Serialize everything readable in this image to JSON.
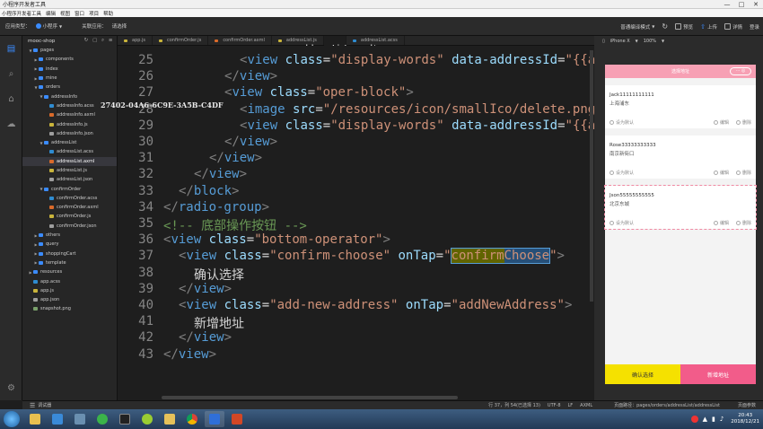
{
  "window": {
    "title": "小程序开发者工具",
    "controls": [
      "—",
      "□",
      "✕"
    ]
  },
  "menu": [
    "小程序开发者工具",
    "编辑",
    "视图",
    "窗口",
    "项目",
    "帮助"
  ],
  "toolbar": {
    "app_type_label": "应用类型：",
    "app_type_value": "小程序",
    "mode_label": "关联应用：",
    "mode_value": "请选择",
    "compile_mode": "普通编译模式",
    "preview_label": "预览",
    "upload_label": "上传",
    "details_label": "详情",
    "login_label": "登录"
  },
  "watermark": "27402-04A6-6C9E-3A5B-C4DF",
  "sidebar": {
    "project": "mooc-shop",
    "tree": [
      {
        "label": "pages",
        "type": "folder",
        "indent": 1,
        "open": true
      },
      {
        "label": "components",
        "type": "folder",
        "indent": 2,
        "open": false
      },
      {
        "label": "index",
        "type": "folder",
        "indent": 2,
        "open": false
      },
      {
        "label": "mine",
        "type": "folder",
        "indent": 2,
        "open": false
      },
      {
        "label": "orders",
        "type": "folder",
        "indent": 2,
        "open": true
      },
      {
        "label": "addressInfo",
        "type": "folder",
        "indent": 3,
        "open": true
      },
      {
        "label": "addressInfo.acss",
        "type": "wxss",
        "indent": 4
      },
      {
        "label": "addressInfo.axml",
        "type": "wxml",
        "indent": 4
      },
      {
        "label": "addressInfo.js",
        "type": "js",
        "indent": 4
      },
      {
        "label": "addressInfo.json",
        "type": "json",
        "indent": 4
      },
      {
        "label": "addressList",
        "type": "folder",
        "indent": 3,
        "open": true
      },
      {
        "label": "addressList.acss",
        "type": "wxss",
        "indent": 4
      },
      {
        "label": "addressList.axml",
        "type": "wxml",
        "indent": 4,
        "selected": true
      },
      {
        "label": "addressList.js",
        "type": "js",
        "indent": 4
      },
      {
        "label": "addressList.json",
        "type": "json",
        "indent": 4
      },
      {
        "label": "confirmOrder",
        "type": "folder",
        "indent": 3,
        "open": true
      },
      {
        "label": "confirmOrder.acss",
        "type": "wxss",
        "indent": 4
      },
      {
        "label": "confirmOrder.axml",
        "type": "wxml",
        "indent": 4
      },
      {
        "label": "confirmOrder.js",
        "type": "js",
        "indent": 4
      },
      {
        "label": "confirmOrder.json",
        "type": "json",
        "indent": 4
      },
      {
        "label": "others",
        "type": "folder",
        "indent": 2,
        "open": false
      },
      {
        "label": "query",
        "type": "folder",
        "indent": 2,
        "open": false
      },
      {
        "label": "shoppingCart",
        "type": "folder",
        "indent": 2,
        "open": false
      },
      {
        "label": "template",
        "type": "folder",
        "indent": 2,
        "open": false
      },
      {
        "label": "resources",
        "type": "folder",
        "indent": 1,
        "open": false
      },
      {
        "label": "app.acss",
        "type": "wxss",
        "indent": 1
      },
      {
        "label": "app.js",
        "type": "js",
        "indent": 1
      },
      {
        "label": "app.json",
        "type": "json",
        "indent": 1
      },
      {
        "label": "snapshot.png",
        "type": "png",
        "indent": 1
      }
    ]
  },
  "tabs": [
    {
      "label": "app.js",
      "type": "js"
    },
    {
      "label": "confirmOrder.js",
      "type": "js"
    },
    {
      "label": "confirmOrder.axml",
      "type": "wxml"
    },
    {
      "label": "addressList.js",
      "type": "js"
    },
    {
      "label": "addressList.axml*",
      "type": "wxml",
      "active": true
    },
    {
      "label": "addressList.acss",
      "type": "wxss"
    }
  ],
  "editor": {
    "lines": [
      {
        "n": "25",
        "indent": 5,
        "html": "<span class=\"p\">&lt;</span><span class=\"t\">view</span> <span class=\"a\">class</span>=<span class=\"s\">\"display-words\"</span> <span class=\"a\">data-addressId</span>=<span class=\"s\">\"{{address.id}}\"</span> <span class=\"a\">on</span>"
      },
      {
        "n": "26",
        "indent": 4,
        "html": "<span class=\"p\">&lt;/</span><span class=\"t\">view</span><span class=\"p\">&gt;</span>"
      },
      {
        "n": "27",
        "indent": 4,
        "html": "<span class=\"p\">&lt;</span><span class=\"t\">view</span> <span class=\"a\">class</span>=<span class=\"s\">\"oper-block\"</span><span class=\"p\">&gt;</span>"
      },
      {
        "n": "28",
        "indent": 5,
        "html": "<span class=\"p\">&lt;</span><span class=\"t\">image</span> <span class=\"a\">src</span>=<span class=\"s\">\"/resources/icon/smallIco/delete.png\"</span> <span class=\"a\">class</span>=<span class=\"s\">\"oper-</span>"
      },
      {
        "n": "29",
        "indent": 5,
        "html": "<span class=\"p\">&lt;</span><span class=\"t\">view</span> <span class=\"a\">class</span>=<span class=\"s\">\"display-words\"</span> <span class=\"a\">data-addressId</span>=<span class=\"s\">\"{{address.id}}\"</span> <span class=\"a\">on</span>"
      },
      {
        "n": "30",
        "indent": 4,
        "html": "<span class=\"p\">&lt;/</span><span class=\"t\">view</span><span class=\"p\">&gt;</span>"
      },
      {
        "n": "31",
        "indent": 3,
        "html": "<span class=\"p\">&lt;/</span><span class=\"t\">view</span><span class=\"p\">&gt;</span>"
      },
      {
        "n": "32",
        "indent": 2,
        "html": "<span class=\"p\">&lt;/</span><span class=\"t\">view</span><span class=\"p\">&gt;</span>"
      },
      {
        "n": "33",
        "indent": 1,
        "html": "<span class=\"p\">&lt;/</span><span class=\"t\">block</span><span class=\"p\">&gt;</span>"
      },
      {
        "n": "34",
        "indent": 0,
        "html": "<span class=\"p\">&lt;/</span><span class=\"t\">radio-group</span><span class=\"p\">&gt;</span>"
      },
      {
        "n": "35",
        "indent": 0,
        "html": "<span class=\"c\">&lt;!-- 底部操作按钮 --&gt;</span>"
      },
      {
        "n": "36",
        "indent": 0,
        "html": "<span class=\"p\">&lt;</span><span class=\"t\">view</span> <span class=\"a\">class</span>=<span class=\"s\">\"bottom-operator\"</span><span class=\"p\">&gt;</span>"
      },
      {
        "n": "37",
        "indent": 1,
        "html": "<span class=\"p\">&lt;</span><span class=\"t\">view</span> <span class=\"a\">class</span>=<span class=\"s\">\"confirm-choose\"</span> <span class=\"a\">onTap</span>=<span class=\"s\">\"<span class=\"hl\"><span class=\"hl2\">confirm</span>Choose</span>\"</span><span class=\"p\">&gt;</span>"
      },
      {
        "n": "38",
        "indent": 2,
        "html": "确认选择"
      },
      {
        "n": "39",
        "indent": 1,
        "html": "<span class=\"p\">&lt;/</span><span class=\"t\">view</span><span class=\"p\">&gt;</span>"
      },
      {
        "n": "40",
        "indent": 1,
        "html": "<span class=\"p\">&lt;</span><span class=\"t\">view</span> <span class=\"a\">class</span>=<span class=\"s\">\"add-new-address\"</span> <span class=\"a\">onTap</span>=<span class=\"s\">\"addNewAddress\"</span><span class=\"p\">&gt;</span>"
      },
      {
        "n": "41",
        "indent": 2,
        "html": "新增地址"
      },
      {
        "n": "42",
        "indent": 1,
        "html": "<span class=\"p\">&lt;/</span><span class=\"t\">view</span><span class=\"p\">&gt;</span>"
      },
      {
        "n": "43",
        "indent": 0,
        "html": "<span class=\"p\">&lt;/</span><span class=\"t\">view</span><span class=\"p\">&gt;</span>"
      }
    ]
  },
  "statusbar": {
    "left": "调试器",
    "position": "行 37，列 54(已选择 13)",
    "encoding": "UTF-8",
    "indent": "LF",
    "lang": "AXML",
    "path": "页面路径：pages/orders/addressList/addressList",
    "params": "页面参数"
  },
  "simulator": {
    "device": "iPhone X",
    "zoom": "100%",
    "nav_title": "选择地址",
    "addresses": [
      {
        "name": "Jack11111111111",
        "address": "上海浦东"
      },
      {
        "name": "Rose33333333333",
        "address": "南京新街口"
      },
      {
        "name": "Json55555555555",
        "address": "北京东城"
      }
    ],
    "default_label": "设为默认",
    "edit_label": "编辑",
    "delete_label": "删除",
    "confirm_button": "确认选择",
    "add_button": "新增地址"
  },
  "taskbar": {
    "time": "20:43",
    "date": "2018/12/21"
  }
}
